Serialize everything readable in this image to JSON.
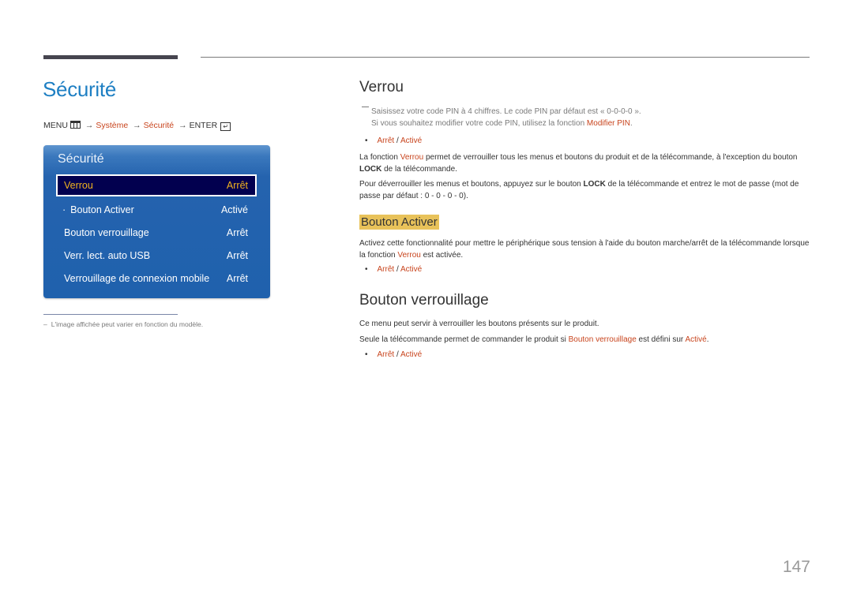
{
  "page": {
    "title": "Sécurité",
    "number": "147"
  },
  "menu_path": {
    "menu": "MENU",
    "menu_icon": "menu-grid-icon",
    "arrow": "→",
    "system": "Système",
    "security": "Sécurité",
    "enter": "ENTER",
    "enter_icon": "enter-icon",
    "enter_glyph": "↵"
  },
  "osd": {
    "title": "Sécurité",
    "items": [
      {
        "label": "Verrou",
        "value": "Arrêt",
        "selected": true
      },
      {
        "label": "Bouton Activer",
        "value": "Activé",
        "sub": true,
        "prefix": "·"
      },
      {
        "label": "Bouton verrouillage",
        "value": "Arrêt"
      },
      {
        "label": "Verr. lect. auto USB",
        "value": "Arrêt"
      },
      {
        "label": "Verrouillage de connexion mobile",
        "value": "Arrêt"
      }
    ]
  },
  "footnote": {
    "dash": "–",
    "text": "L'image affichée peut varier en fonction du modèle."
  },
  "sections": {
    "verrou": {
      "title": "Verrou",
      "note_line1": "Saisissez votre code PIN à 4 chiffres. Le code PIN par défaut est « 0-0-0-0 ».",
      "note_line2_prefix": "Si vous souhaitez modifier votre code PIN, utilisez la fonction ",
      "note_line2_link": "Modifier PIN",
      "note_line2_suffix": ".",
      "options": {
        "bullet": "•",
        "off": "Arrêt",
        "sep": " / ",
        "on": "Activé"
      },
      "para1_a": "La fonction ",
      "para1_link": "Verrou",
      "para1_b": " permet de verrouiller tous les menus et boutons du produit et de la télécommande, à l'exception du bouton ",
      "para1_bold": "LOCK",
      "para1_c": " de la télécommande.",
      "para2_a": "Pour déverrouiller les menus et boutons, appuyez sur le bouton ",
      "para2_bold": "LOCK",
      "para2_b": " de la télécommande et entrez le mot de passe (mot de passe par défaut : 0 - 0 - 0 - 0)."
    },
    "bouton_activer": {
      "title": "Bouton Activer",
      "para_a": "Activez cette fonctionnalité pour mettre le périphérique sous tension à l'aide du bouton marche/arrêt de la télécommande lorsque la fonction ",
      "para_link": "Verrou",
      "para_b": " est activée.",
      "options": {
        "bullet": "•",
        "off": "Arrêt",
        "sep": " / ",
        "on": "Activé"
      }
    },
    "bouton_verrouillage": {
      "title": "Bouton verrouillage",
      "para1": "Ce menu peut servir à verrouiller les boutons présents sur le produit.",
      "para2_a": "Seule la télécommande permet de commander le produit si ",
      "para2_link": "Bouton verrouillage",
      "para2_b": " est défini sur ",
      "para2_link2": "Activé",
      "para2_c": ".",
      "options": {
        "bullet": "•",
        "off": "Arrêt",
        "sep": " / ",
        "on": "Activé"
      }
    }
  },
  "colors": {
    "title_blue": "#1e7fc3",
    "link_orange": "#c8441d",
    "osd_blue": "#1f61ad",
    "osd_selected_bg": "#02004f",
    "osd_selected_text": "#f2b31f",
    "highlight_yellow": "#e8c25a"
  }
}
